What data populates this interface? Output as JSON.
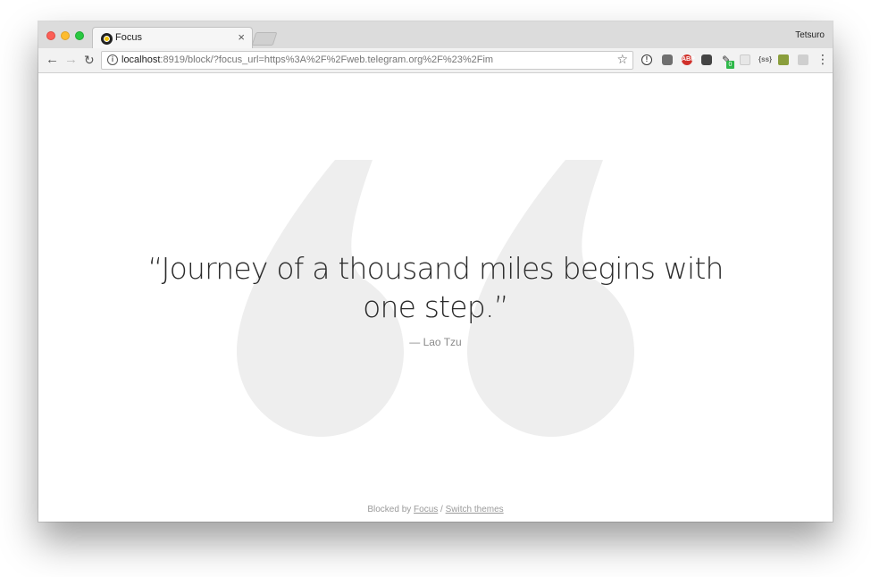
{
  "browser": {
    "tab": {
      "title": "Focus",
      "close_glyph": "×"
    },
    "profile_name": "Tetsuro",
    "address_bar": {
      "host": "localhost",
      "rest": ":8919/block/?focus_url=https%3A%2F%2Fweb.telegram.org%2F%23%2Fim"
    },
    "icons": {
      "back": "back-arrow-icon",
      "forward": "forward-arrow-icon",
      "reload": "reload-icon",
      "info": "info-icon",
      "bookmark": "star-icon",
      "menu": "menu-dots-icon"
    },
    "extensions": {
      "abp_label": "ABP",
      "badge_count": "0",
      "json_label": "{ss}"
    }
  },
  "page": {
    "quote": "“Journey of a thousand miles begins with one step.”",
    "author": "— Lao Tzu",
    "footer": {
      "prefix": "Blocked by ",
      "focus_link": "Focus",
      "separator": " / ",
      "themes_link": "Switch themes"
    }
  },
  "colors": {
    "quote_mark": "#eeeeee",
    "quote_text": "#2b2b2b",
    "author_text": "#8a8a8a"
  }
}
